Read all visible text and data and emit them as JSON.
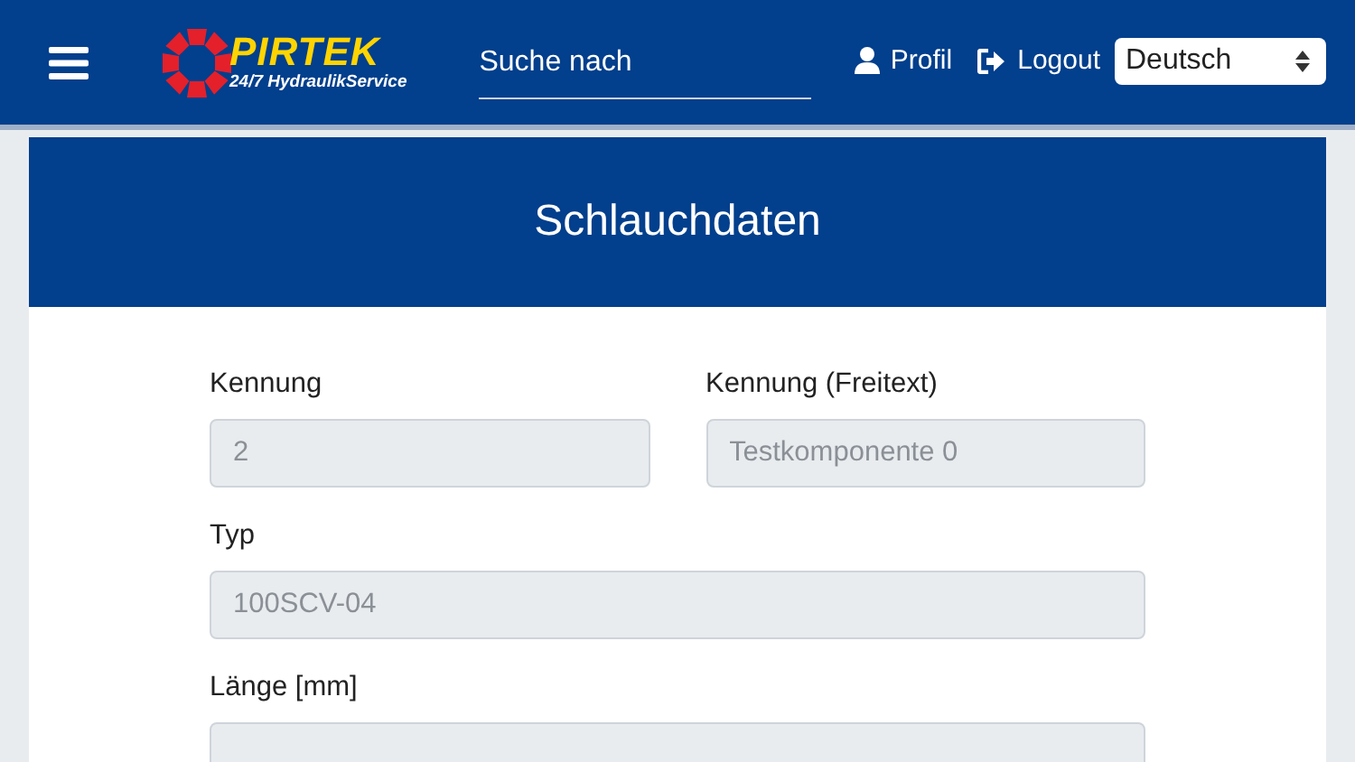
{
  "header": {
    "logo": {
      "name": "PIRTEK",
      "tagline": "24/7 HydraulikService"
    },
    "search": {
      "placeholder": "Suche nach"
    },
    "links": [
      {
        "kind": "profile",
        "label": "Profil"
      },
      {
        "kind": "logout",
        "label": "Logout"
      }
    ],
    "language": {
      "value": "Deutsch"
    }
  },
  "card": {
    "title": "Schlauchdaten",
    "rows": [
      [
        {
          "label": "Kennung",
          "value": "2",
          "disabled": true
        },
        {
          "label": "Kennung (Freitext)",
          "value": "Testkomponente 0",
          "disabled": true
        }
      ],
      [
        {
          "label": "Typ",
          "value": "100SCV-04",
          "disabled": true
        }
      ],
      [
        {
          "label": "Länge [mm]",
          "disabled": true
        }
      ]
    ]
  }
}
